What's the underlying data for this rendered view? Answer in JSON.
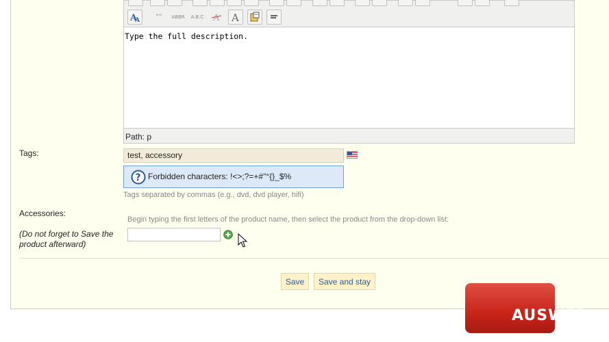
{
  "editor": {
    "toolbar_row2": [
      "font-a-icon",
      "quote-icon",
      "abbr-icon",
      "acronym-icon",
      "strike-icon",
      "font-color-icon",
      "paste-icon",
      "align-icon"
    ],
    "body_text": "Type the full description.",
    "path": "Path: p"
  },
  "tags": {
    "label": "Tags:",
    "value": "test, accessory",
    "flag_icon": "us-flag-icon",
    "hint_icon": "question-icon",
    "hint": "Forbidden characters: !<>;?=+#\"°{}_$%",
    "help": "Tags separated by commas (e.g., dvd, dvd player, hifi)"
  },
  "accessories": {
    "label": "Accessories:",
    "note": "(Do not forget to Save the product afterward)",
    "help": "Begin typing the first letters of the product name, then select the product from the drop-down list:",
    "input_value": "",
    "add_icon": "add-icon"
  },
  "actions": {
    "save": "Save",
    "save_stay": "Save and stay"
  },
  "watermark": {
    "text": "AUSWEB",
    "color": "#d6291e"
  }
}
